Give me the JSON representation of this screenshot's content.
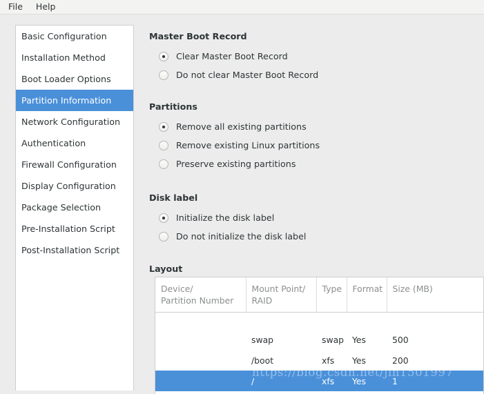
{
  "menubar": {
    "items": [
      {
        "label": "File",
        "name": "menu-file"
      },
      {
        "label": "Help",
        "name": "menu-help"
      }
    ]
  },
  "sidebar": {
    "items": [
      {
        "label": "Basic Configuration",
        "selected": false
      },
      {
        "label": "Installation Method",
        "selected": false
      },
      {
        "label": "Boot Loader Options",
        "selected": false
      },
      {
        "label": "Partition Information",
        "selected": true
      },
      {
        "label": "Network Configuration",
        "selected": false
      },
      {
        "label": "Authentication",
        "selected": false
      },
      {
        "label": "Firewall Configuration",
        "selected": false
      },
      {
        "label": "Display Configuration",
        "selected": false
      },
      {
        "label": "Package Selection",
        "selected": false
      },
      {
        "label": "Pre-Installation Script",
        "selected": false
      },
      {
        "label": "Post-Installation Script",
        "selected": false
      }
    ]
  },
  "main": {
    "groups": [
      {
        "title": "Master Boot Record",
        "options": [
          {
            "label": "Clear Master Boot Record",
            "checked": true
          },
          {
            "label": "Do not clear Master Boot Record",
            "checked": false
          }
        ]
      },
      {
        "title": "Partitions",
        "options": [
          {
            "label": "Remove all existing partitions",
            "checked": true
          },
          {
            "label": "Remove existing Linux partitions",
            "checked": false
          },
          {
            "label": "Preserve existing partitions",
            "checked": false
          }
        ]
      },
      {
        "title": "Disk label",
        "options": [
          {
            "label": "Initialize the disk label",
            "checked": true
          },
          {
            "label": "Do not initialize the disk label",
            "checked": false
          }
        ]
      }
    ],
    "layout_title": "Layout",
    "table": {
      "columns": [
        "Device/\nPartition Number",
        "Mount Point/\nRAID",
        "Type",
        "Format",
        "Size (MB)"
      ],
      "rows": [
        {
          "device": "",
          "mount": "",
          "type": "",
          "format": "",
          "size": "",
          "selected": false
        },
        {
          "device": "",
          "mount": "swap",
          "type": "swap",
          "format": "Yes",
          "size": "500",
          "selected": false
        },
        {
          "device": "",
          "mount": "/boot",
          "type": "xfs",
          "format": "Yes",
          "size": "200",
          "selected": false
        },
        {
          "device": "",
          "mount": "/",
          "type": "xfs",
          "format": "Yes",
          "size": "1",
          "selected": true
        }
      ]
    }
  },
  "watermark": {
    "text": "https://blog.csdn.net/jin1501997"
  },
  "colors": {
    "selection_blue": "#4a90d9",
    "window_bg": "#ececec",
    "panel_bg": "#ffffff",
    "text": "#2e3436",
    "header_text": "#8b8e8f",
    "border": "#cdcdcd"
  }
}
